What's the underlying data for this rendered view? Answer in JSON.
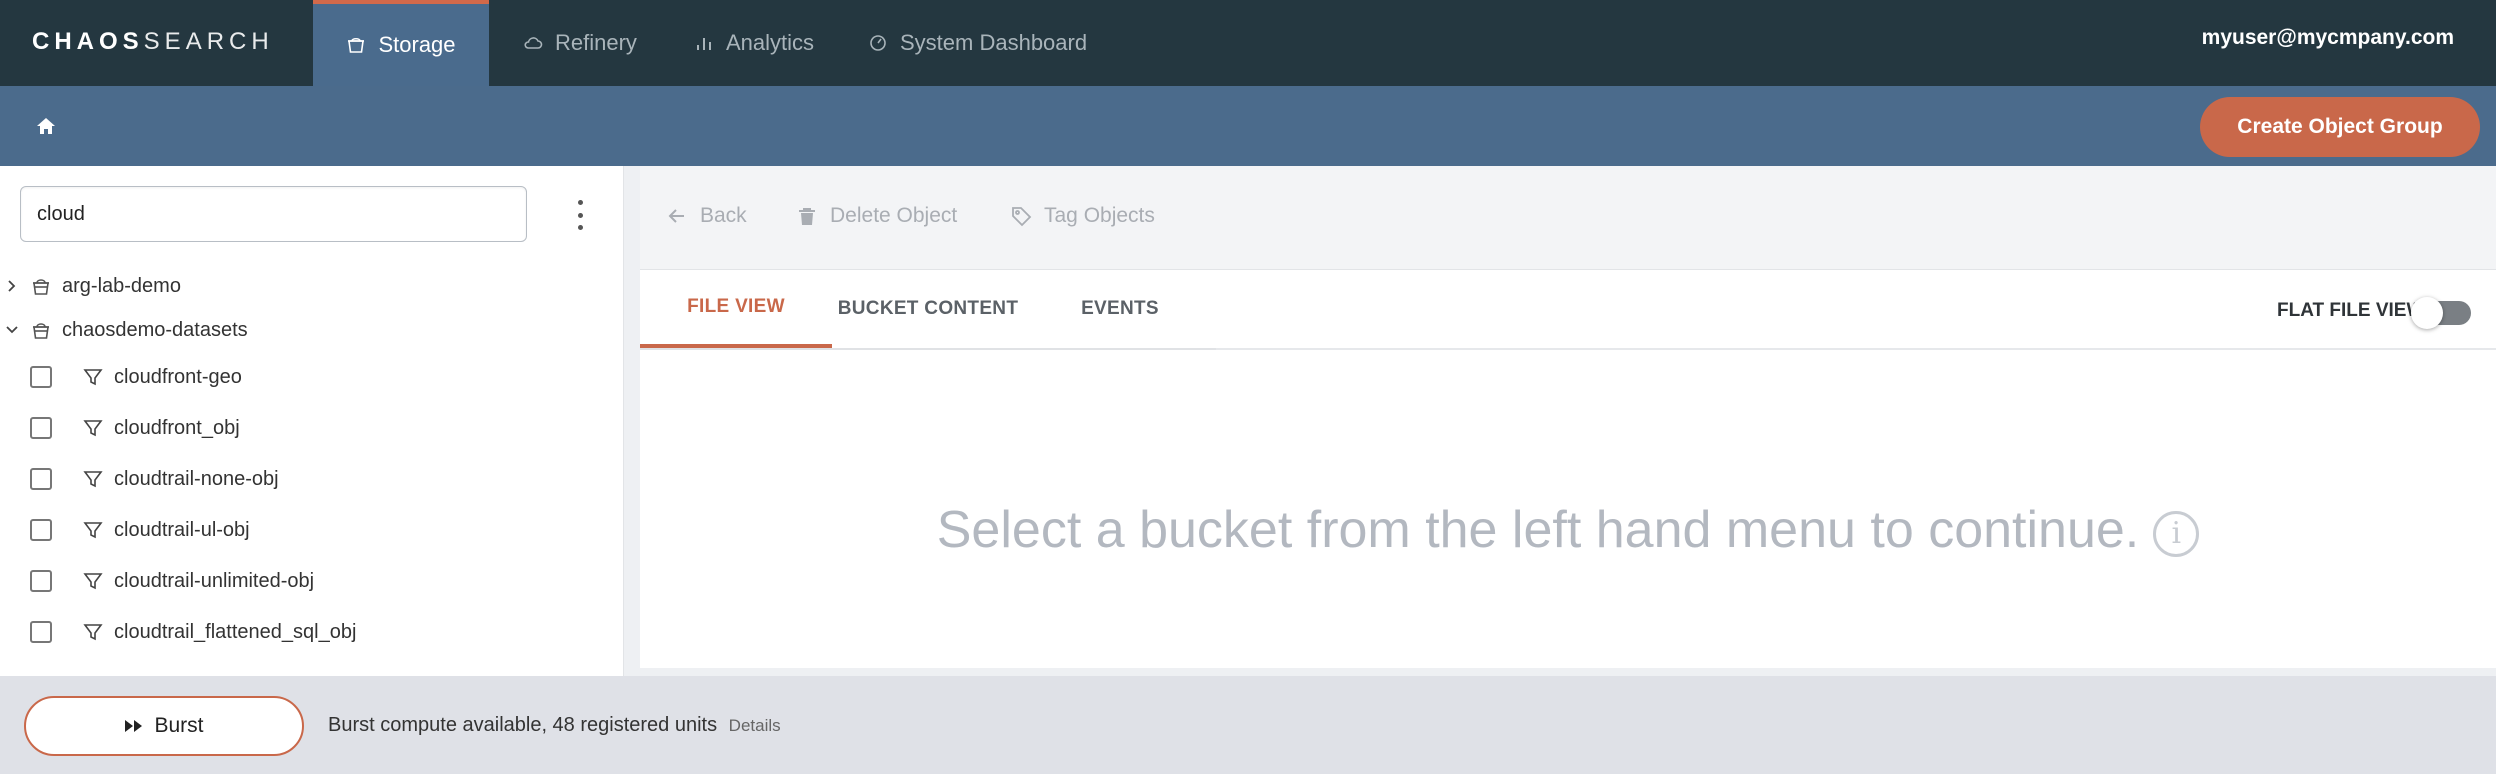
{
  "logo": {
    "part1": "CHAOS",
    "part2": "SEARCH"
  },
  "nav": {
    "tabs": [
      {
        "label": "Storage",
        "icon": "bucket-icon",
        "active": true
      },
      {
        "label": "Refinery",
        "icon": "cloud-icon",
        "active": false
      },
      {
        "label": "Analytics",
        "icon": "bar-chart-icon",
        "active": false
      },
      {
        "label": "System Dashboard",
        "icon": "gauge-icon",
        "active": false
      }
    ],
    "user": "myuser@mycmpany.com"
  },
  "subheader": {
    "home_icon": "home-icon",
    "create_label": "Create Object Group"
  },
  "sidebar": {
    "search_value": "cloud",
    "buckets": [
      {
        "name": "arg-lab-demo",
        "expanded": false
      },
      {
        "name": "chaosdemo-datasets",
        "expanded": true
      }
    ],
    "objects": [
      "cloudfront-geo",
      "cloudfront_obj",
      "cloudtrail-none-obj",
      "cloudtrail-ul-obj",
      "cloudtrail-unlimited-obj",
      "cloudtrail_flattened_sql_obj"
    ]
  },
  "toolbar": {
    "back": "Back",
    "delete": "Delete Object",
    "tag": "Tag Objects"
  },
  "tabs": [
    {
      "label": "FILE VIEW",
      "active": true
    },
    {
      "label": "BUCKET CONTENT",
      "active": false
    },
    {
      "label": "EVENTS",
      "active": false
    }
  ],
  "flat_file_view": {
    "label": "FLAT FILE VIEW",
    "on": false
  },
  "empty_message": "Select a bucket from the left hand menu to continue.",
  "info_glyph": "i",
  "footer": {
    "burst_label": "Burst",
    "status": "Burst compute available, 48 registered units",
    "details": "Details"
  },
  "colors": {
    "nav_bg": "#243740",
    "subheader_bg": "#4b6b8c",
    "accent": "#c9684a"
  }
}
